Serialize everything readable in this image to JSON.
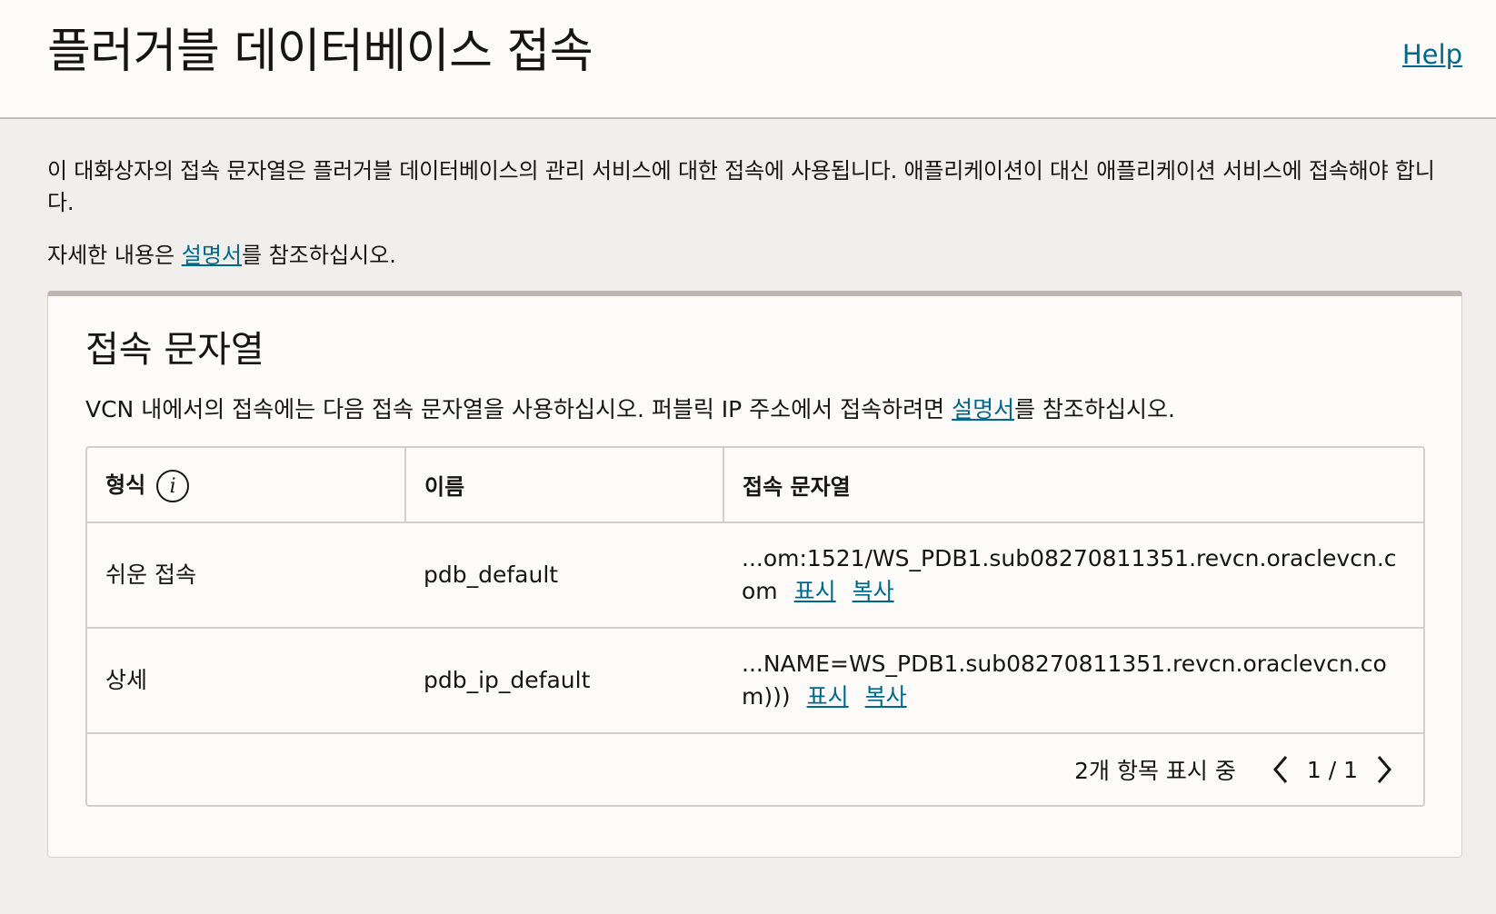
{
  "header": {
    "title": "플러거블 데이터베이스 접속",
    "help_label": "Help"
  },
  "intro": {
    "text": "이 대화상자의 접속 문자열은 플러거블 데이터베이스의 관리 서비스에 대한 접속에 사용됩니다. 애플리케이션이 대신 애플리케이션 서비스에 접속해야 합니다.",
    "more_prefix": "자세한 내용은 ",
    "more_link": "설명서",
    "more_suffix": "를 참조하십시오."
  },
  "card": {
    "title": "접속 문자열",
    "desc_prefix": "VCN 내에서의 접속에는 다음 접속 문자열을 사용하십시오. 퍼블릭 IP 주소에서 접속하려면 ",
    "desc_link": "설명서",
    "desc_suffix": "를 참조하십시오."
  },
  "table": {
    "columns": [
      "형식",
      "이름",
      "접속 문자열"
    ],
    "rows": [
      {
        "format": "쉬운 접속",
        "name": "pdb_default",
        "connection": "...om:1521/WS_PDB1.sub08270811351.revcn.oraclevcn.com",
        "show": "표시",
        "copy": "복사"
      },
      {
        "format": "상세",
        "name": "pdb_ip_default",
        "connection": "...NAME=WS_PDB1.sub08270811351.revcn.oraclevcn.com)))",
        "show": "표시",
        "copy": "복사"
      }
    ]
  },
  "pager": {
    "status": "2개 항목 표시 중",
    "page": "1 / 1"
  },
  "icons": {
    "info": "info-icon",
    "prev": "chevron-left-icon",
    "next": "chevron-right-icon"
  },
  "colors": {
    "link": "#00688c",
    "background": "#f1efed",
    "card_top_border": "#bcb6b0"
  }
}
